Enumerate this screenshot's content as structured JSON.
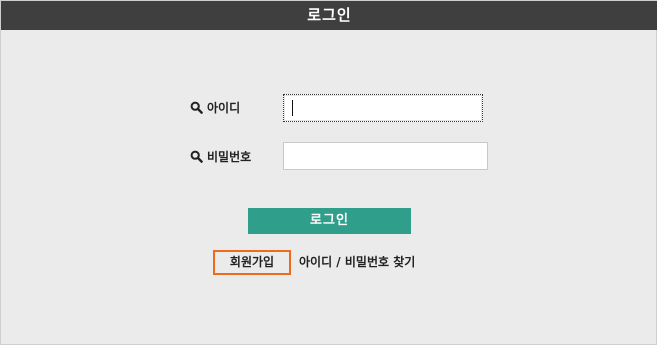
{
  "header": {
    "title": "로그인"
  },
  "form": {
    "id_label": "아이디",
    "id_icon": "search-icon",
    "id_value": "",
    "password_label": "비밀번호",
    "password_icon": "search-icon",
    "password_value": ""
  },
  "actions": {
    "login_label": "로그인",
    "signup_label": "회원가입",
    "find_label": "아이디 / 비밀번호 찾기"
  },
  "colors": {
    "title_bar": "#3f3f3f",
    "background": "#ebebeb",
    "login_button": "#2f9e8b",
    "signup_highlight": "#ef6a1a"
  }
}
